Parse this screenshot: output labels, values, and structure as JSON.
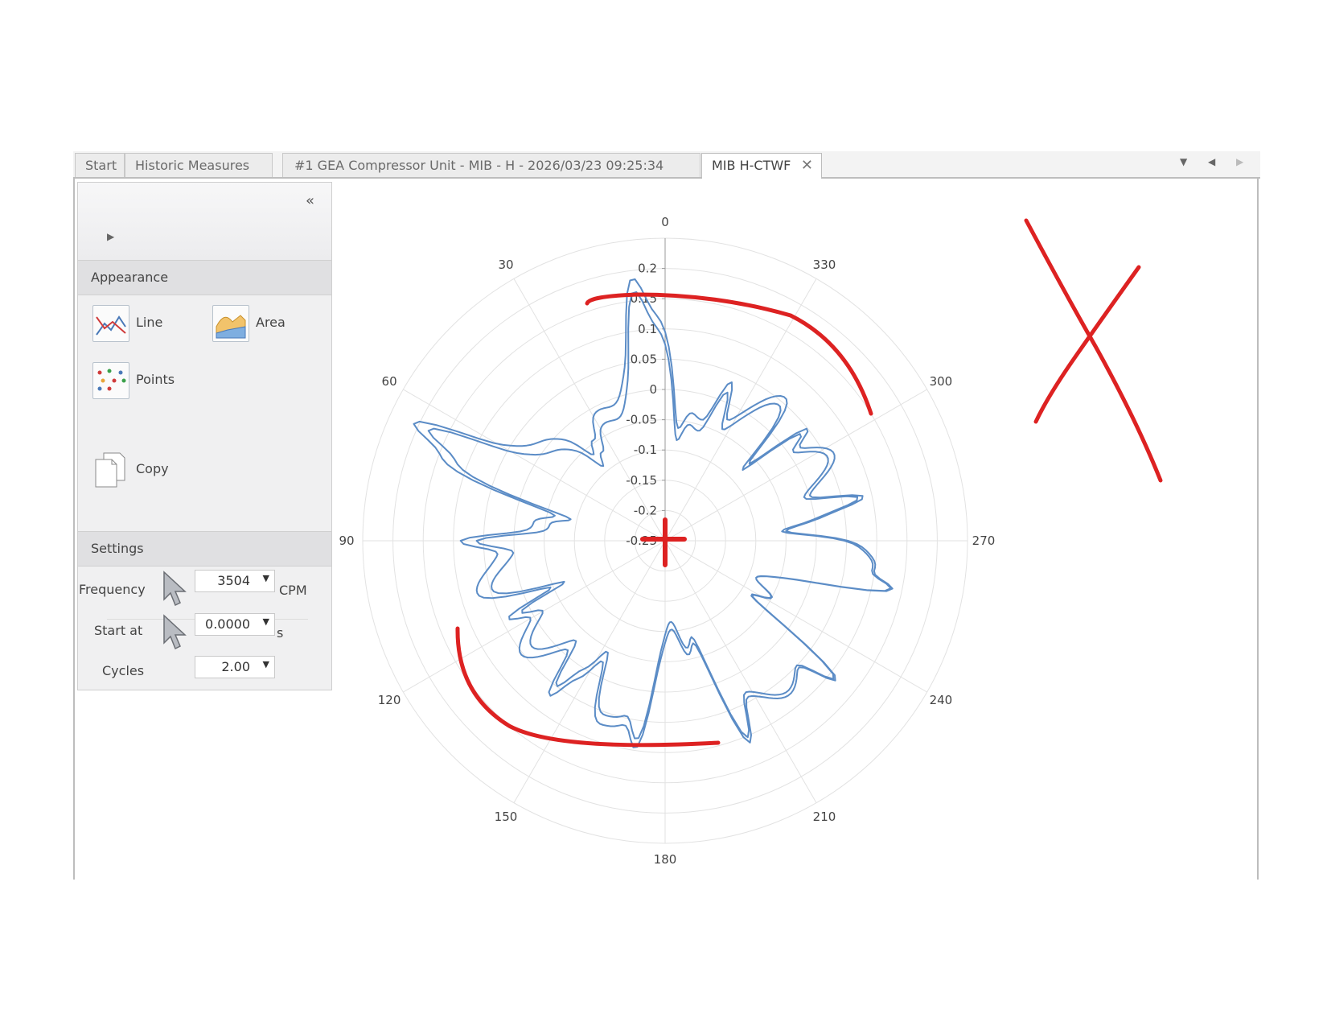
{
  "tabs": [
    {
      "label": "Start"
    },
    {
      "label": "Historic Measures"
    },
    {
      "label": "#1 GEA Compressor Unit - MIB - H - 2026/03/23 09:25:34"
    },
    {
      "label": "MIB H-CTWF"
    }
  ],
  "panel": {
    "collapse_glyph": "«",
    "appearance": {
      "title": "Appearance",
      "line": "Line",
      "area": "Area",
      "points": "Points",
      "copy": "Copy"
    },
    "settings": {
      "title": "Settings",
      "frequency_label": "Frequency",
      "frequency_value": "3504",
      "frequency_unit": "CPM",
      "start_label": "Start at",
      "start_value": "0.0000",
      "start_unit": "s",
      "cycles_label": "Cycles",
      "cycles_value": "2.00"
    }
  },
  "chart_data": {
    "type": "polar-line",
    "angle_direction": "counter-clockwise",
    "angle_zero": "top",
    "angle_ticks": [
      "0",
      "30",
      "60",
      "90",
      "120",
      "150",
      "180",
      "210",
      "240",
      "270",
      "300",
      "330"
    ],
    "radial_ticks": [
      "0.2",
      "0.15",
      "0.1",
      "0.05",
      "0",
      "-0.05",
      "-0.1",
      "-0.15",
      "-0.2",
      "-0.25"
    ],
    "radial_range": [
      -0.25,
      0.25
    ],
    "series_color": "#5b8cc6",
    "annotation_color": "#dd2222",
    "grid": true
  }
}
